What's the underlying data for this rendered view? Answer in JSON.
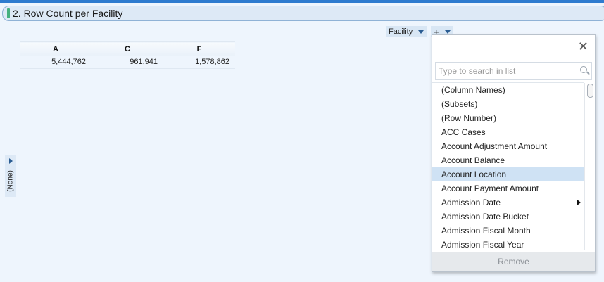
{
  "visualization": {
    "title": "2. Row Count per Facility"
  },
  "axis": {
    "column_label": "Facility",
    "add_label": "+"
  },
  "left_axis": {
    "label": "(None)"
  },
  "table": {
    "headers": [
      "A",
      "C",
      "F"
    ],
    "rows": [
      [
        "5,444,762",
        "961,941",
        "1,578,862"
      ]
    ]
  },
  "dropdown": {
    "search_placeholder": "Type to search in list",
    "items": [
      {
        "label": "(Column Names)",
        "selected": false,
        "has_submenu": false
      },
      {
        "label": "(Subsets)",
        "selected": false,
        "has_submenu": false
      },
      {
        "label": "(Row Number)",
        "selected": false,
        "has_submenu": false
      },
      {
        "label": "ACC Cases",
        "selected": false,
        "has_submenu": false
      },
      {
        "label": "Account Adjustment Amount",
        "selected": false,
        "has_submenu": false
      },
      {
        "label": "Account Balance",
        "selected": false,
        "has_submenu": false
      },
      {
        "label": "Account Location",
        "selected": true,
        "has_submenu": false
      },
      {
        "label": "Account Payment Amount",
        "selected": false,
        "has_submenu": false
      },
      {
        "label": "Admission Date",
        "selected": false,
        "has_submenu": true
      },
      {
        "label": "Admission Date Bucket",
        "selected": false,
        "has_submenu": false
      },
      {
        "label": "Admission Fiscal Month",
        "selected": false,
        "has_submenu": false
      },
      {
        "label": "Admission Fiscal Year",
        "selected": false,
        "has_submenu": false
      }
    ],
    "remove_label": "Remove"
  }
}
